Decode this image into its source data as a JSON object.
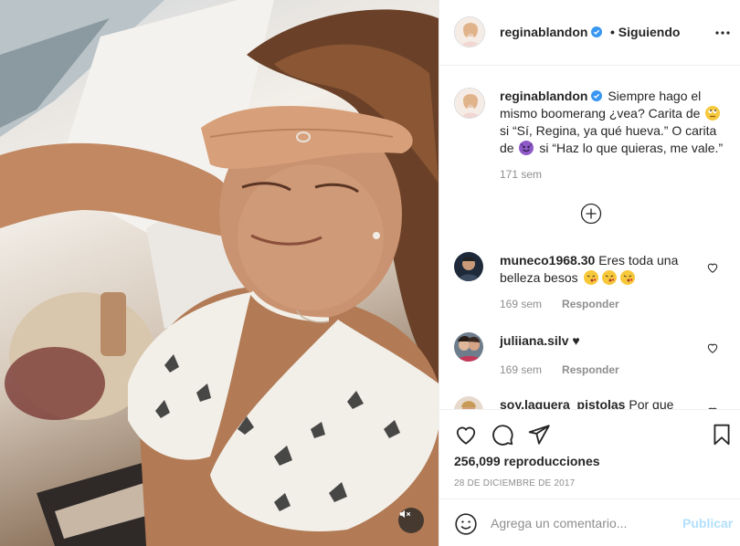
{
  "post": {
    "media": {
      "description_icon": "video-frame",
      "mute_icon": "speaker-muted-icon"
    },
    "header": {
      "username": "reginablandon",
      "verified": true,
      "separator": "•",
      "follow_status": "Siguiendo",
      "more_icon": "ellipsis-icon"
    },
    "caption": {
      "username": "reginablandon",
      "text_part1": "Siempre hago el mismo boomerang ¿vea? Carita de",
      "text_part2": "si “Sí, Regina, ya qué hueva.” O carita de",
      "text_part3": "si “Haz lo que quieras, me vale.”",
      "emoji1": "eye-roll-emoji",
      "emoji2": "smiling-devil-emoji",
      "age": "171 sem"
    },
    "load_more_icon": "plus-circle-icon",
    "comments": [
      {
        "username": "muneco1968.30",
        "text": "Eres toda una belleza besos",
        "emojis": "kissing-face-emoji x3",
        "age": "169 sem",
        "reply": "Responder"
      },
      {
        "username": "juliiana.silv",
        "text": "♥",
        "age": "169 sem",
        "reply": "Responder"
      },
      {
        "username": "soy.laguera_pistolas",
        "text": "Por que eres"
      }
    ],
    "actions": {
      "like_icon": "heart-icon",
      "comment_icon": "comment-icon",
      "share_icon": "paper-plane-icon",
      "save_icon": "bookmark-icon"
    },
    "views": "256,099 reproducciones",
    "date": "28 DE DICIEMBRE DE 2017",
    "composer": {
      "emoji_icon": "smiley-icon",
      "placeholder": "Agrega un comentario...",
      "publish": "Publicar"
    }
  },
  "colors": {
    "text": "#262626",
    "secondary": "#8e8e8e",
    "verified": "#3897f0",
    "publish_disabled": "#b2dffc",
    "border": "#efefef"
  }
}
